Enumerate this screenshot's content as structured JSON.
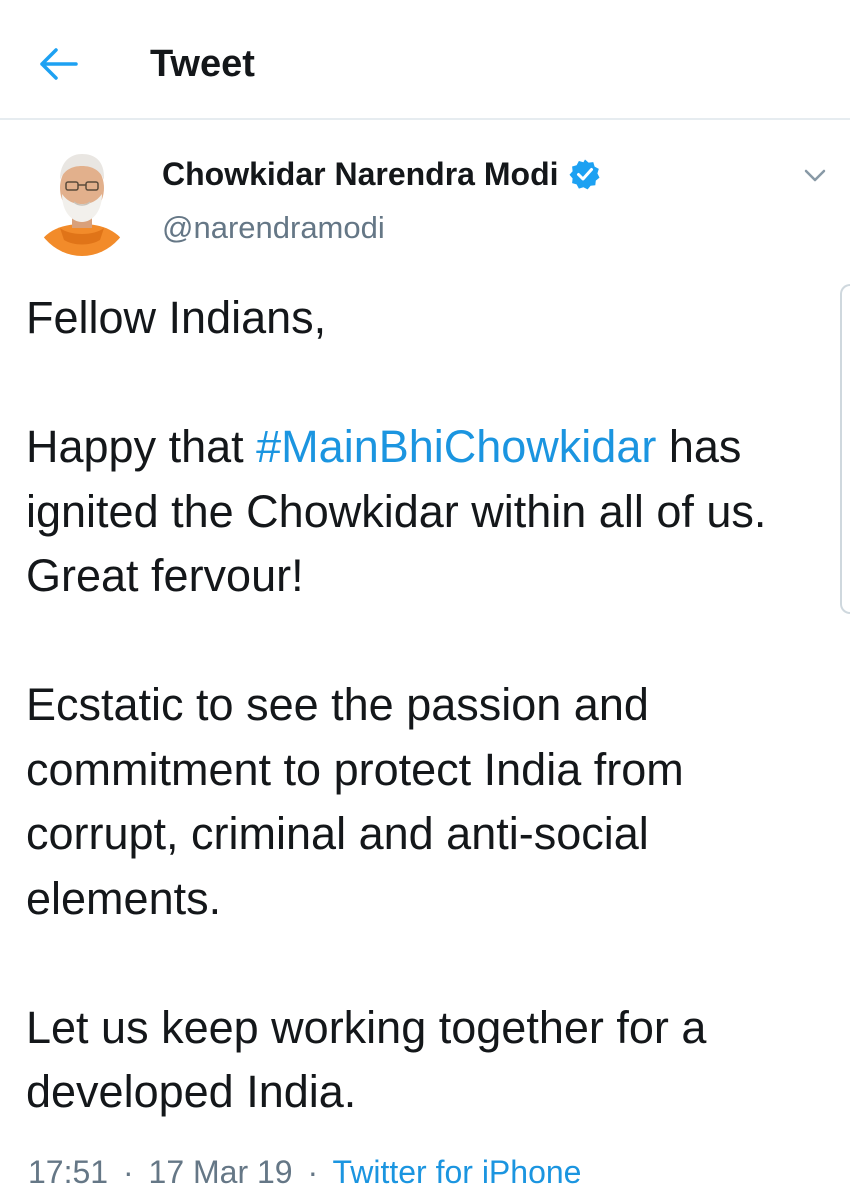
{
  "header": {
    "title": "Tweet",
    "back_icon": "arrow-left-icon",
    "accent_color": "#1da1f2"
  },
  "tweet": {
    "author": {
      "name": "Chowkidar Narendra Modi",
      "handle": "@narendramodi",
      "verified_icon": "verified-badge-icon",
      "avatar_icon": "profile-photo"
    },
    "more_icon": "chevron-down-icon",
    "body": {
      "p1": "Fellow Indians,",
      "p2_before": "Happy that ",
      "p2_hashtag": "#MainBhiChowkidar",
      "p2_after": " has ignited the Chowkidar within all of us. Great fervour!",
      "p3": "Ecstatic to see the passion and commitment to protect India from corrupt, criminal and anti-social elements.",
      "p4": "Let us keep working together for a developed India."
    },
    "meta": {
      "time": "17:51",
      "separator": "·",
      "date": "17 Mar 19",
      "source": "Twitter for iPhone"
    },
    "colors": {
      "link": "#1b95e0",
      "muted": "#657786",
      "text": "#14171a"
    }
  }
}
